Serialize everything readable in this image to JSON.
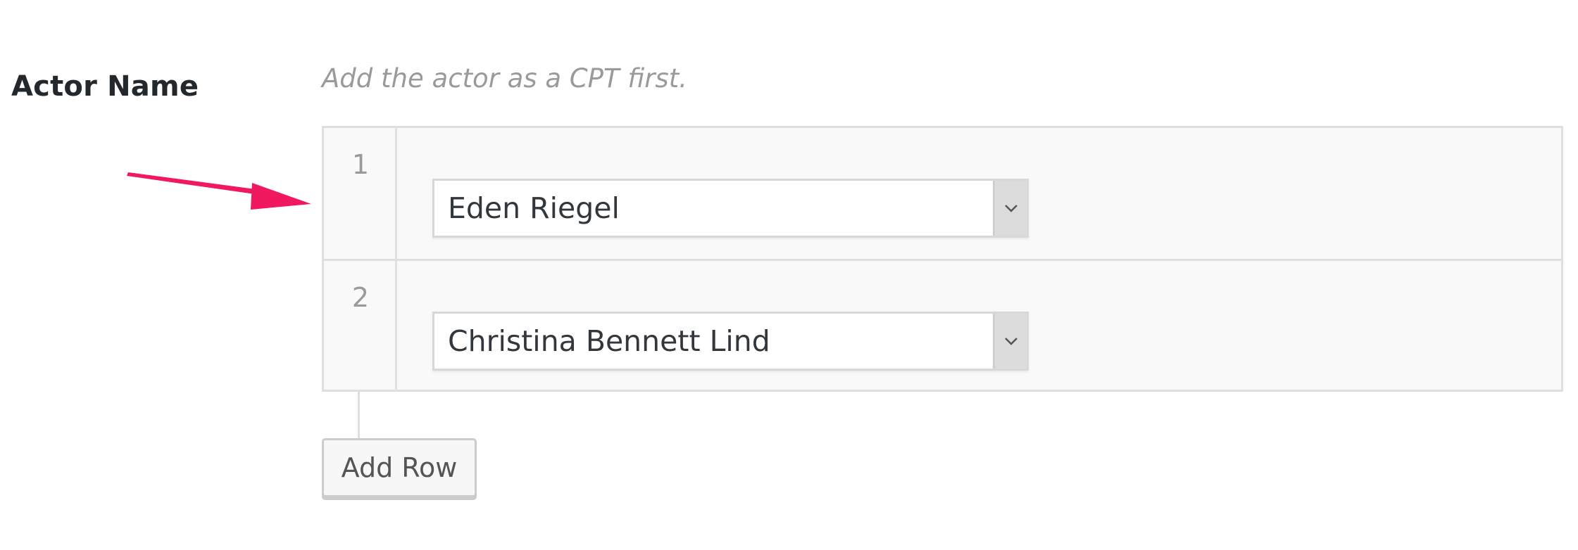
{
  "field": {
    "label": "Actor Name",
    "description": "Add the actor as a CPT first."
  },
  "repeater": {
    "rows": [
      {
        "number": "1",
        "selected": "Eden Riegel"
      },
      {
        "number": "2",
        "selected": "Christina Bennett Lind"
      }
    ],
    "add_row_label": "Add Row"
  },
  "icons": {
    "annotation": "arrow-right-icon",
    "select_toggle": "chevron-down-icon"
  },
  "colors": {
    "annotation_arrow": "#f0195f",
    "label_text": "#23282d",
    "description_text": "#9a9a9a"
  }
}
